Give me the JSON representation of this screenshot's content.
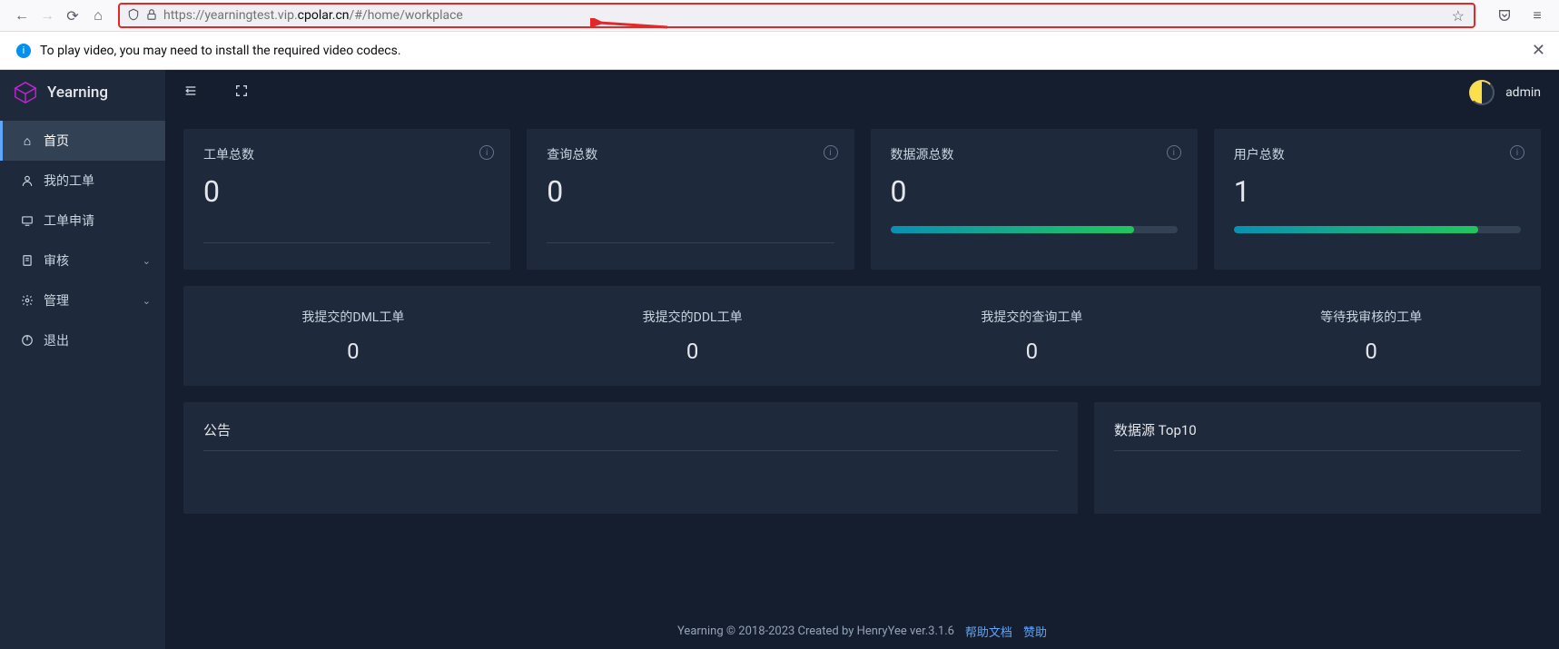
{
  "browser": {
    "url_prefix": "https://yearningtest.vip.",
    "url_domain": "cpolar.cn",
    "url_path": "/#/home/workplace",
    "notification": "To play video, you may need to install the required video codecs."
  },
  "app": {
    "brand": "Yearning",
    "username": "admin",
    "menu": [
      {
        "label": "首页",
        "icon": "⌂"
      },
      {
        "label": "我的工单",
        "icon": "◇"
      },
      {
        "label": "工单申请",
        "icon": "▭"
      },
      {
        "label": "审核",
        "icon": "▤",
        "chevron": true
      },
      {
        "label": "管理",
        "icon": "⚙",
        "chevron": true
      },
      {
        "label": "退出",
        "icon": "↻"
      }
    ],
    "stats": [
      {
        "title": "工单总数",
        "value": "0",
        "progress": null
      },
      {
        "title": "查询总数",
        "value": "0",
        "progress": null
      },
      {
        "title": "数据源总数",
        "value": "0",
        "progress": 85
      },
      {
        "title": "用户总数",
        "value": "1",
        "progress": 85
      }
    ],
    "submits": [
      {
        "label": "我提交的DML工单",
        "value": "0"
      },
      {
        "label": "我提交的DDL工单",
        "value": "0"
      },
      {
        "label": "我提交的查询工单",
        "value": "0"
      },
      {
        "label": "等待我审核的工单",
        "value": "0"
      }
    ],
    "panels": {
      "announce": "公告",
      "top": "数据源 Top10"
    },
    "footer": {
      "copyright": "Yearning © 2018-2023 Created by HenryYee ver.3.1.6",
      "help": "帮助文档",
      "donate": "赞助"
    }
  }
}
